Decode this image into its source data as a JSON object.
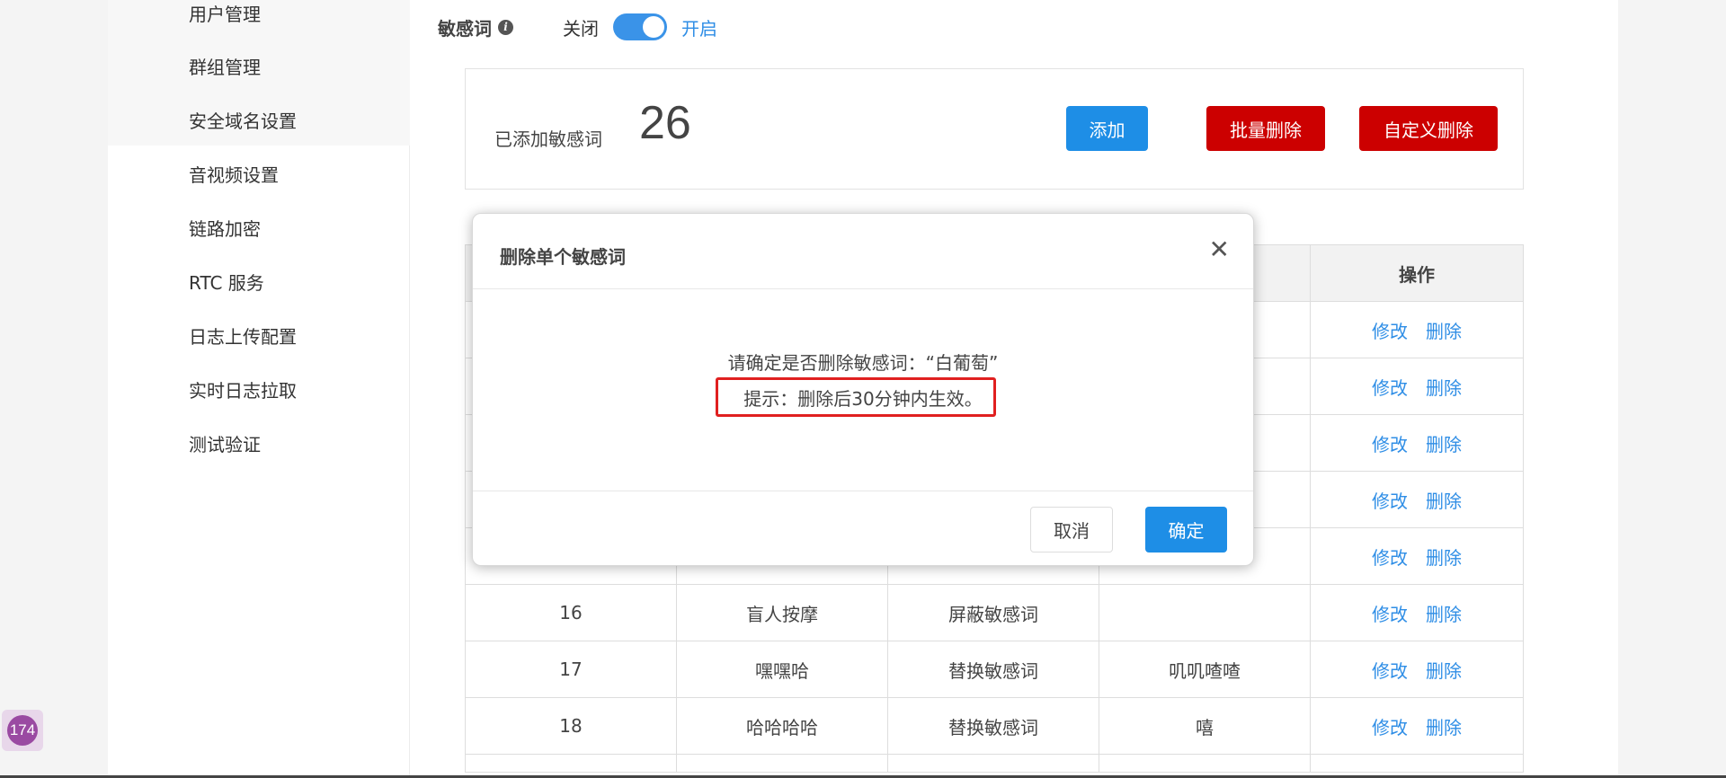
{
  "sidebar": {
    "items": [
      {
        "label": "用户管理"
      },
      {
        "label": "群组管理"
      },
      {
        "label": "安全域名设置"
      },
      {
        "label": "音视频设置"
      },
      {
        "label": "链路加密"
      },
      {
        "label": "RTC 服务"
      },
      {
        "label": "日志上传配置"
      },
      {
        "label": "实时日志拉取"
      },
      {
        "label": "测试验证"
      }
    ]
  },
  "switch": {
    "title": "敏感词",
    "info_icon": "info-icon",
    "off_label": "关闭",
    "on_label": "开启",
    "state": "on",
    "accent": "#3a93e8"
  },
  "summary": {
    "label": "已添加敏感词",
    "count": "26",
    "add_label": "添加",
    "batch_delete_label": "批量删除",
    "custom_delete_label": "自定义删除"
  },
  "table": {
    "action_header": "操作",
    "rows": [
      {
        "index": "",
        "word": "",
        "type": "",
        "replace": "",
        "edit": "修改",
        "delete": "删除"
      },
      {
        "index": "",
        "word": "",
        "type": "",
        "replace": "",
        "edit": "修改",
        "delete": "删除"
      },
      {
        "index": "",
        "word": "",
        "type": "",
        "replace": "",
        "edit": "修改",
        "delete": "删除"
      },
      {
        "index": "",
        "word": "",
        "type": "",
        "replace": "",
        "edit": "修改",
        "delete": "删除"
      },
      {
        "index": "",
        "word": "",
        "type": "",
        "replace": "",
        "edit": "修改",
        "delete": "删除"
      },
      {
        "index": "16",
        "word": "盲人按摩",
        "type": "屏蔽敏感词",
        "replace": "",
        "edit": "修改",
        "delete": "删除"
      },
      {
        "index": "17",
        "word": "嘿嘿哈",
        "type": "替换敏感词",
        "replace": "叽叽喳喳",
        "edit": "修改",
        "delete": "删除"
      },
      {
        "index": "18",
        "word": "哈哈哈哈",
        "type": "替换敏感词",
        "replace": "嘻",
        "edit": "修改",
        "delete": "删除"
      }
    ]
  },
  "modal": {
    "title": "删除单个敏感词",
    "close_icon": "close-icon",
    "message": "请确定是否删除敏感词：“白葡萄”",
    "tip": "提示：删除后30分钟内生效。",
    "cancel_label": "取消",
    "confirm_label": "确定",
    "highlight_color": "#e02020"
  },
  "page_badge": "174"
}
